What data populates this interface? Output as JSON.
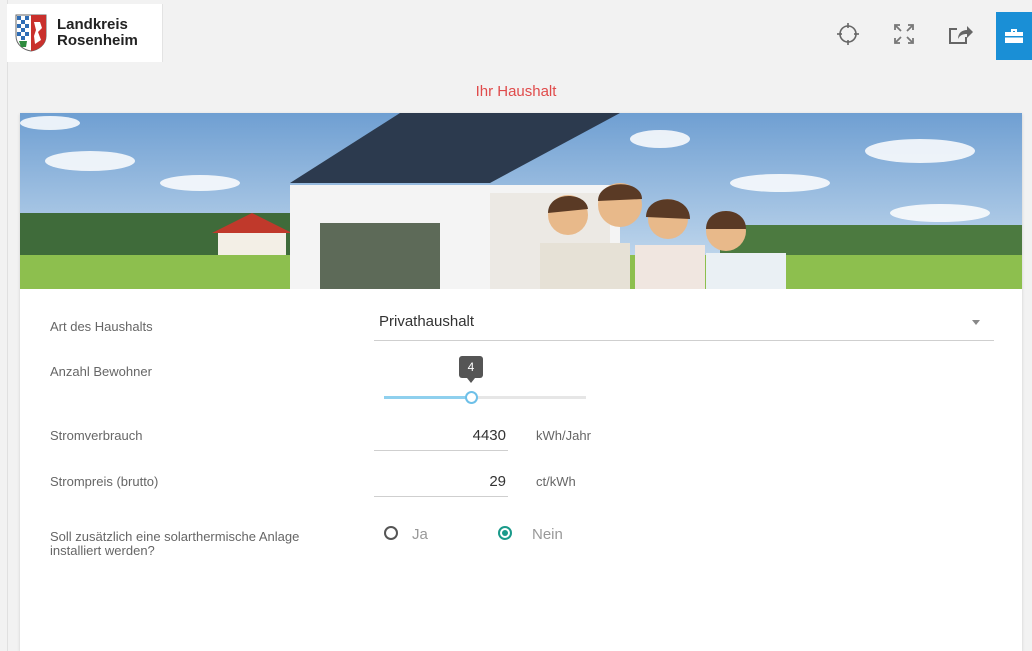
{
  "header": {
    "logo_line1": "Landkreis",
    "logo_line2": "Rosenheim",
    "icons": [
      "crosshair-icon",
      "fullscreen-icon",
      "share-icon",
      "toolbox-icon"
    ],
    "accent_color": "#1a8fd6"
  },
  "page_title": "Ihr Haushalt",
  "form": {
    "household_type": {
      "label": "Art des Haushalts",
      "value": "Privathaushalt"
    },
    "residents": {
      "label": "Anzahl Bewohner",
      "value": "4",
      "fraction": 0.43
    },
    "consumption": {
      "label": "Stromverbrauch",
      "value": "4430",
      "unit": "kWh/Jahr"
    },
    "price": {
      "label": "Strompreis (brutto)",
      "value": "29",
      "unit": "ct/kWh"
    },
    "solarthermal": {
      "label_line1": "Soll zusätzlich eine solarthermische Anlage",
      "label_line2": "installiert werden?",
      "option_yes": "Ja",
      "option_no": "Nein",
      "selected": "Nein",
      "selected_color": "#1a9a8a"
    }
  }
}
